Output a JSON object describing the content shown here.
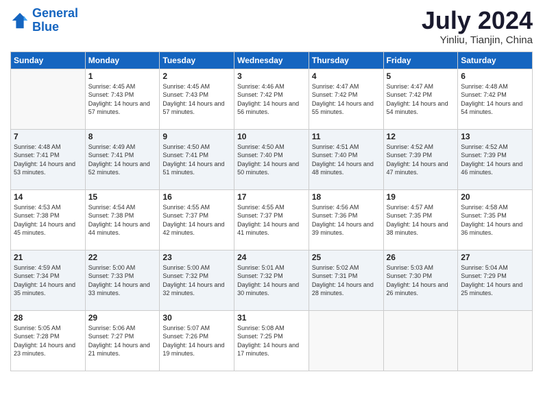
{
  "logo": {
    "text_general": "General",
    "text_blue": "Blue"
  },
  "title": {
    "month_year": "July 2024",
    "location": "Yinliu, Tianjin, China"
  },
  "headers": [
    "Sunday",
    "Monday",
    "Tuesday",
    "Wednesday",
    "Thursday",
    "Friday",
    "Saturday"
  ],
  "weeks": [
    {
      "shaded": false,
      "days": [
        {
          "num": "",
          "sunrise": "",
          "sunset": "",
          "daylight": "",
          "empty": true
        },
        {
          "num": "1",
          "sunrise": "Sunrise: 4:45 AM",
          "sunset": "Sunset: 7:43 PM",
          "daylight": "Daylight: 14 hours and 57 minutes."
        },
        {
          "num": "2",
          "sunrise": "Sunrise: 4:45 AM",
          "sunset": "Sunset: 7:43 PM",
          "daylight": "Daylight: 14 hours and 57 minutes."
        },
        {
          "num": "3",
          "sunrise": "Sunrise: 4:46 AM",
          "sunset": "Sunset: 7:42 PM",
          "daylight": "Daylight: 14 hours and 56 minutes."
        },
        {
          "num": "4",
          "sunrise": "Sunrise: 4:47 AM",
          "sunset": "Sunset: 7:42 PM",
          "daylight": "Daylight: 14 hours and 55 minutes."
        },
        {
          "num": "5",
          "sunrise": "Sunrise: 4:47 AM",
          "sunset": "Sunset: 7:42 PM",
          "daylight": "Daylight: 14 hours and 54 minutes."
        },
        {
          "num": "6",
          "sunrise": "Sunrise: 4:48 AM",
          "sunset": "Sunset: 7:42 PM",
          "daylight": "Daylight: 14 hours and 54 minutes."
        }
      ]
    },
    {
      "shaded": true,
      "days": [
        {
          "num": "7",
          "sunrise": "Sunrise: 4:48 AM",
          "sunset": "Sunset: 7:41 PM",
          "daylight": "Daylight: 14 hours and 53 minutes."
        },
        {
          "num": "8",
          "sunrise": "Sunrise: 4:49 AM",
          "sunset": "Sunset: 7:41 PM",
          "daylight": "Daylight: 14 hours and 52 minutes."
        },
        {
          "num": "9",
          "sunrise": "Sunrise: 4:50 AM",
          "sunset": "Sunset: 7:41 PM",
          "daylight": "Daylight: 14 hours and 51 minutes."
        },
        {
          "num": "10",
          "sunrise": "Sunrise: 4:50 AM",
          "sunset": "Sunset: 7:40 PM",
          "daylight": "Daylight: 14 hours and 50 minutes."
        },
        {
          "num": "11",
          "sunrise": "Sunrise: 4:51 AM",
          "sunset": "Sunset: 7:40 PM",
          "daylight": "Daylight: 14 hours and 48 minutes."
        },
        {
          "num": "12",
          "sunrise": "Sunrise: 4:52 AM",
          "sunset": "Sunset: 7:39 PM",
          "daylight": "Daylight: 14 hours and 47 minutes."
        },
        {
          "num": "13",
          "sunrise": "Sunrise: 4:52 AM",
          "sunset": "Sunset: 7:39 PM",
          "daylight": "Daylight: 14 hours and 46 minutes."
        }
      ]
    },
    {
      "shaded": false,
      "days": [
        {
          "num": "14",
          "sunrise": "Sunrise: 4:53 AM",
          "sunset": "Sunset: 7:38 PM",
          "daylight": "Daylight: 14 hours and 45 minutes."
        },
        {
          "num": "15",
          "sunrise": "Sunrise: 4:54 AM",
          "sunset": "Sunset: 7:38 PM",
          "daylight": "Daylight: 14 hours and 44 minutes."
        },
        {
          "num": "16",
          "sunrise": "Sunrise: 4:55 AM",
          "sunset": "Sunset: 7:37 PM",
          "daylight": "Daylight: 14 hours and 42 minutes."
        },
        {
          "num": "17",
          "sunrise": "Sunrise: 4:55 AM",
          "sunset": "Sunset: 7:37 PM",
          "daylight": "Daylight: 14 hours and 41 minutes."
        },
        {
          "num": "18",
          "sunrise": "Sunrise: 4:56 AM",
          "sunset": "Sunset: 7:36 PM",
          "daylight": "Daylight: 14 hours and 39 minutes."
        },
        {
          "num": "19",
          "sunrise": "Sunrise: 4:57 AM",
          "sunset": "Sunset: 7:35 PM",
          "daylight": "Daylight: 14 hours and 38 minutes."
        },
        {
          "num": "20",
          "sunrise": "Sunrise: 4:58 AM",
          "sunset": "Sunset: 7:35 PM",
          "daylight": "Daylight: 14 hours and 36 minutes."
        }
      ]
    },
    {
      "shaded": true,
      "days": [
        {
          "num": "21",
          "sunrise": "Sunrise: 4:59 AM",
          "sunset": "Sunset: 7:34 PM",
          "daylight": "Daylight: 14 hours and 35 minutes."
        },
        {
          "num": "22",
          "sunrise": "Sunrise: 5:00 AM",
          "sunset": "Sunset: 7:33 PM",
          "daylight": "Daylight: 14 hours and 33 minutes."
        },
        {
          "num": "23",
          "sunrise": "Sunrise: 5:00 AM",
          "sunset": "Sunset: 7:32 PM",
          "daylight": "Daylight: 14 hours and 32 minutes."
        },
        {
          "num": "24",
          "sunrise": "Sunrise: 5:01 AM",
          "sunset": "Sunset: 7:32 PM",
          "daylight": "Daylight: 14 hours and 30 minutes."
        },
        {
          "num": "25",
          "sunrise": "Sunrise: 5:02 AM",
          "sunset": "Sunset: 7:31 PM",
          "daylight": "Daylight: 14 hours and 28 minutes."
        },
        {
          "num": "26",
          "sunrise": "Sunrise: 5:03 AM",
          "sunset": "Sunset: 7:30 PM",
          "daylight": "Daylight: 14 hours and 26 minutes."
        },
        {
          "num": "27",
          "sunrise": "Sunrise: 5:04 AM",
          "sunset": "Sunset: 7:29 PM",
          "daylight": "Daylight: 14 hours and 25 minutes."
        }
      ]
    },
    {
      "shaded": false,
      "days": [
        {
          "num": "28",
          "sunrise": "Sunrise: 5:05 AM",
          "sunset": "Sunset: 7:28 PM",
          "daylight": "Daylight: 14 hours and 23 minutes."
        },
        {
          "num": "29",
          "sunrise": "Sunrise: 5:06 AM",
          "sunset": "Sunset: 7:27 PM",
          "daylight": "Daylight: 14 hours and 21 minutes."
        },
        {
          "num": "30",
          "sunrise": "Sunrise: 5:07 AM",
          "sunset": "Sunset: 7:26 PM",
          "daylight": "Daylight: 14 hours and 19 minutes."
        },
        {
          "num": "31",
          "sunrise": "Sunrise: 5:08 AM",
          "sunset": "Sunset: 7:25 PM",
          "daylight": "Daylight: 14 hours and 17 minutes."
        },
        {
          "num": "",
          "sunrise": "",
          "sunset": "",
          "daylight": "",
          "empty": true
        },
        {
          "num": "",
          "sunrise": "",
          "sunset": "",
          "daylight": "",
          "empty": true
        },
        {
          "num": "",
          "sunrise": "",
          "sunset": "",
          "daylight": "",
          "empty": true
        }
      ]
    }
  ]
}
